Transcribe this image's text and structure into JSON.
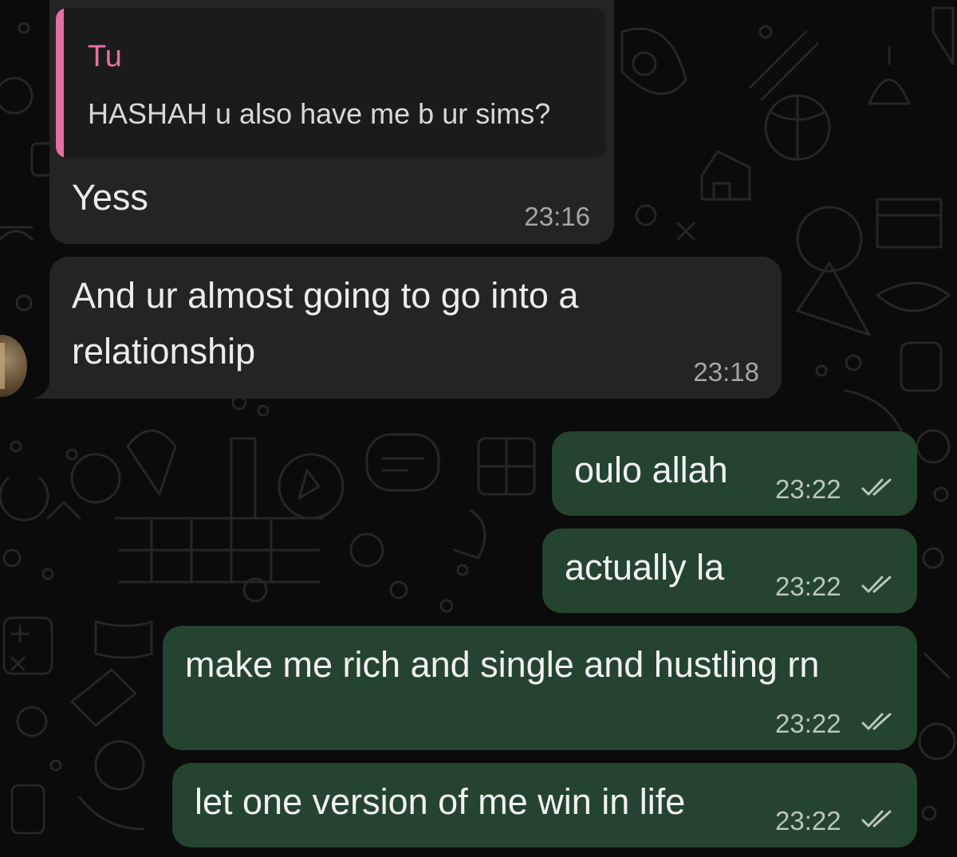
{
  "colors": {
    "background": "#0b0b0b",
    "incoming_bubble": "#242424",
    "outgoing_bubble": "#24442f",
    "quote_accent": "#ea6fa6"
  },
  "messages": {
    "m1": {
      "reply": {
        "author": "Tu",
        "text": "HASHAH u also have me b ur sims?"
      },
      "text": "Yess",
      "time": "23:16"
    },
    "m2": {
      "line1": "And ur almost going to go into a",
      "line2": "relationship",
      "time": "23:18"
    },
    "m3": {
      "text": "oulo allah",
      "time": "23:22"
    },
    "m4": {
      "text": "actually la",
      "time": "23:22"
    },
    "m5": {
      "text": "make me rich and single and hustling rn",
      "time": "23:22"
    },
    "m6": {
      "text": "let one version of me win in life",
      "time": "23:22"
    }
  },
  "icons": {
    "read_receipt": "double-check-icon",
    "avatar": "contact-avatar"
  }
}
